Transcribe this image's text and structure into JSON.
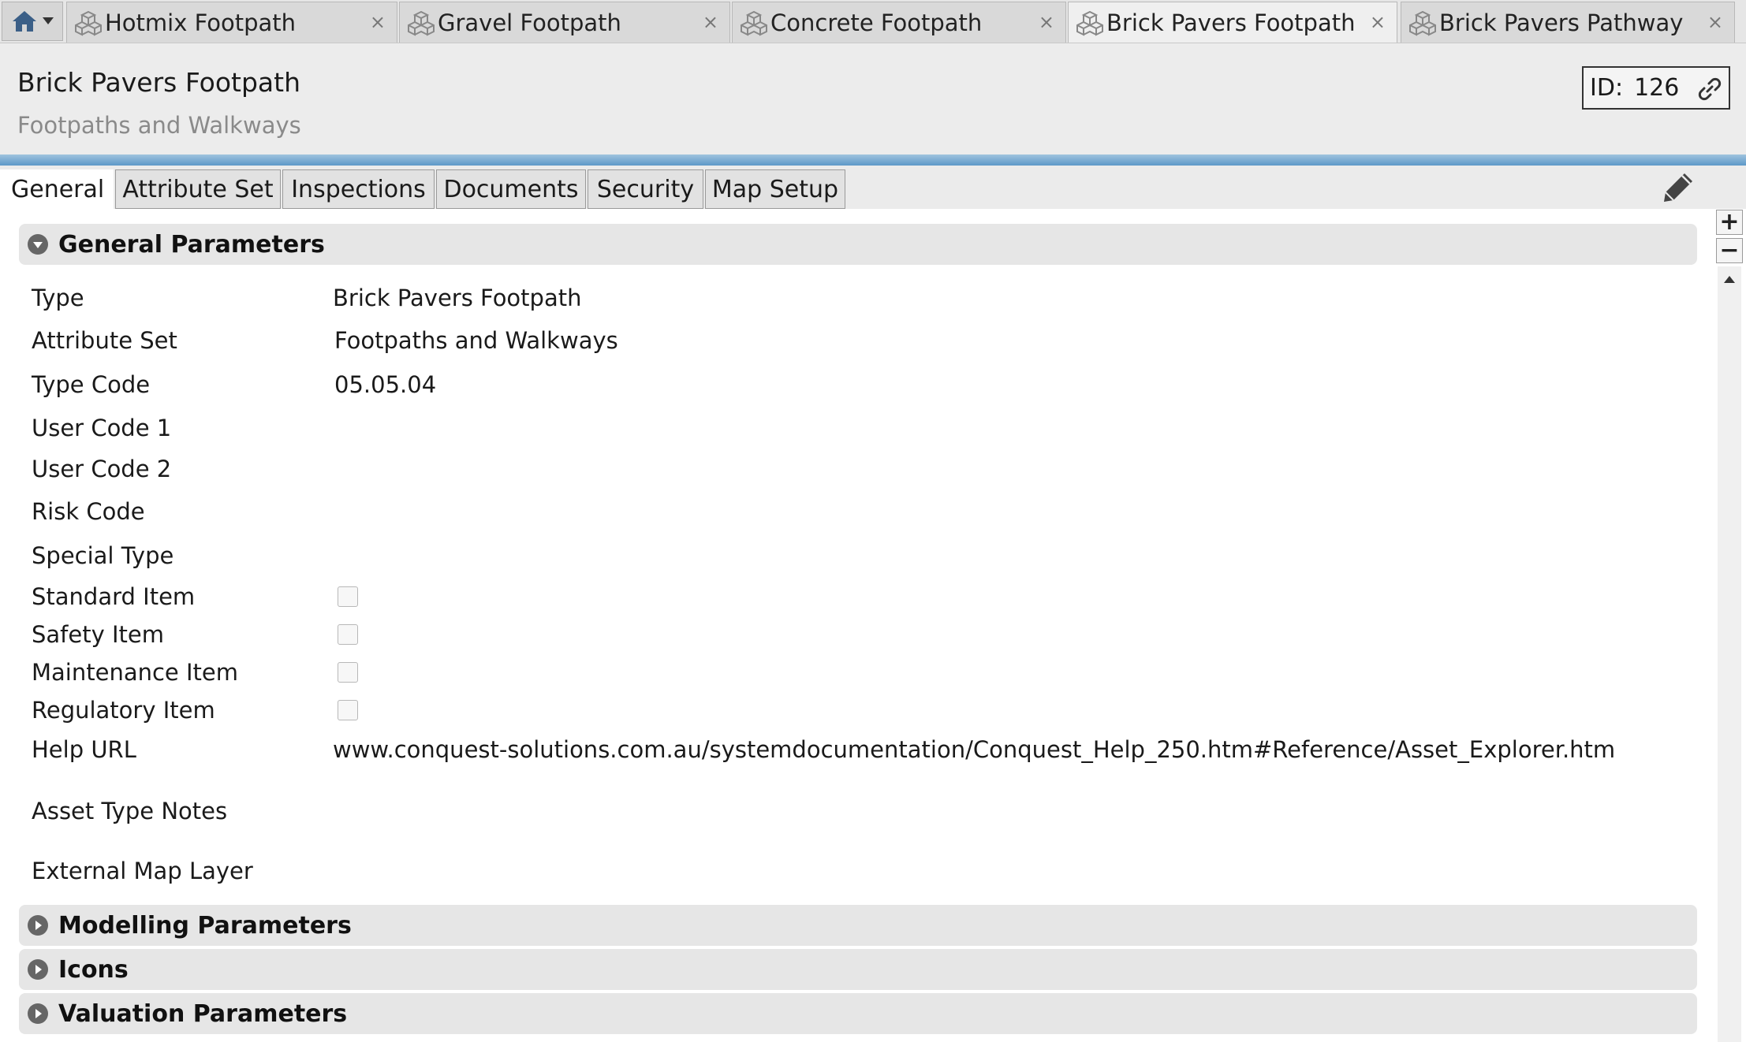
{
  "doc_tabs": {
    "home": {
      "icon": "home-icon",
      "dropdown_icon": "caret-down-icon"
    },
    "items": [
      {
        "label": "Hotmix Footpath",
        "icon": "asset-type-icon",
        "close": "×"
      },
      {
        "label": "Gravel Footpath",
        "icon": "asset-type-icon",
        "close": "×"
      },
      {
        "label": "Concrete Footpath",
        "icon": "asset-type-icon",
        "close": "×"
      },
      {
        "label": "Brick Pavers Footpath",
        "icon": "asset-type-icon",
        "close": "×",
        "active": true
      },
      {
        "label": "Brick Pavers Pathway",
        "icon": "asset-type-icon",
        "close": "×"
      }
    ]
  },
  "header": {
    "title": "Brick Pavers Footpath",
    "subtitle": "Footpaths and Walkways",
    "id_label": "ID:",
    "id_value": "126",
    "link_icon": "link-icon"
  },
  "section_tabs": [
    {
      "label": "General",
      "active": true
    },
    {
      "label": "Attribute Set"
    },
    {
      "label": "Inspections"
    },
    {
      "label": "Documents"
    },
    {
      "label": "Security"
    },
    {
      "label": "Map Setup"
    }
  ],
  "toolbar": {
    "edit_icon": "pencil-icon",
    "zoom_in": "+",
    "zoom_out": "−",
    "scroll_up_icon": "scroll-up-arrow-icon"
  },
  "sections": {
    "general": {
      "title": "General Parameters",
      "expanded": true
    },
    "modelling": {
      "title": "Modelling Parameters",
      "expanded": false
    },
    "icons": {
      "title": "Icons",
      "expanded": false
    },
    "valuation": {
      "title": "Valuation Parameters",
      "expanded": false
    }
  },
  "fields": {
    "type": {
      "label": "Type",
      "value": "Brick Pavers Footpath"
    },
    "attribute_set": {
      "label": "Attribute Set",
      "value": "Footpaths and Walkways"
    },
    "type_code": {
      "label": "Type Code",
      "value": "05.05.04"
    },
    "user_code_1": {
      "label": "User Code 1",
      "value": ""
    },
    "user_code_2": {
      "label": "User Code 2",
      "value": ""
    },
    "risk_code": {
      "label": "Risk Code",
      "value": ""
    },
    "special_type": {
      "label": "Special Type",
      "value": ""
    },
    "standard_item": {
      "label": "Standard Item",
      "checked": false
    },
    "safety_item": {
      "label": "Safety Item",
      "checked": false
    },
    "maintenance_item": {
      "label": "Maintenance Item",
      "checked": false
    },
    "regulatory_item": {
      "label": "Regulatory Item",
      "checked": false
    },
    "help_url": {
      "label": "Help URL",
      "value": "www.conquest-solutions.com.au/systemdocumentation/Conquest_Help_250.htm#Reference/Asset_Explorer.htm"
    },
    "asset_type_notes": {
      "label": "Asset Type Notes",
      "value": ""
    },
    "external_map_layer": {
      "label": "External Map Layer",
      "value": ""
    }
  }
}
